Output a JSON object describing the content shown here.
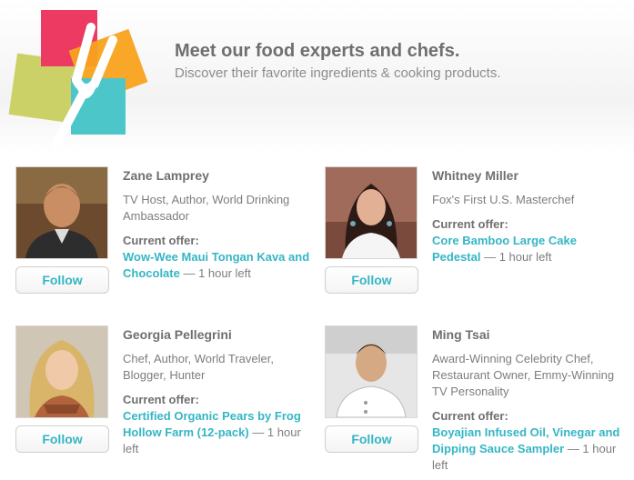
{
  "header": {
    "title": "Meet our food experts and chefs.",
    "subtitle": "Discover their favorite ingredients & cooking products."
  },
  "colors": {
    "accent": "#34b6c4",
    "logo_pink": "#ec3a63",
    "logo_orange": "#f8a21d",
    "logo_green": "#c9cf5f",
    "logo_teal": "#4cc6c9"
  },
  "experts": [
    {
      "name": "Zane Lamprey",
      "bio": "TV Host, Author, World Drinking Ambassador",
      "offer_label": "Current offer:",
      "offer_title": "Wow-Wee Maui Tongan Kava and Chocolate",
      "offer_time": " — 1 hour left",
      "follow_label": "Follow"
    },
    {
      "name": "Whitney Miller",
      "bio": "Fox's First U.S. Masterchef",
      "offer_label": "Current offer:",
      "offer_title": "Core Bamboo Large Cake Pedestal",
      "offer_time": " — 1 hour left",
      "follow_label": "Follow"
    },
    {
      "name": "Georgia Pellegrini",
      "bio": "Chef, Author, World Traveler, Blogger, Hunter",
      "offer_label": "Current offer:",
      "offer_title": "Certified Organic Pears by Frog Hollow Farm (12-pack)",
      "offer_time": " — 1 hour left",
      "follow_label": "Follow"
    },
    {
      "name": "Ming Tsai",
      "bio": "Award-Winning Celebrity Chef, Restaurant Owner, Emmy-Winning TV Personality",
      "offer_label": "Current offer:",
      "offer_title": "Boyajian Infused Oil, Vinegar and Dipping Sauce Sampler",
      "offer_time": " — 1 hour left",
      "follow_label": "Follow"
    }
  ]
}
